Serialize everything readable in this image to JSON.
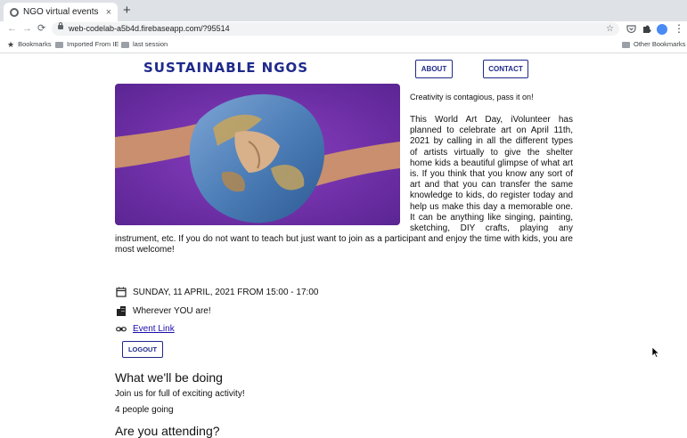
{
  "browser": {
    "tab_title": "NGO virtual events",
    "tab_close": "×",
    "new_tab": "+",
    "back": "←",
    "forward": "→",
    "reload": "⟳",
    "url": "web-codelab-a5b4d.firebaseapp.com/?95514",
    "bookmark_star": "☆",
    "menu": "⋮",
    "bookmarks_bar": {
      "bookmarks_label": "Bookmarks",
      "imported_label": "Imported From IE",
      "last_session_label": "last session",
      "other_bookmarks_label": "Other Bookmarks"
    }
  },
  "header": {
    "site_title": "SUSTAINABLE NGOS",
    "nav": [
      {
        "label": "ABOUT"
      },
      {
        "label": "CONTACT"
      }
    ]
  },
  "event": {
    "tagline": "Creativity is contagious, pass it on!",
    "description": "This World Art Day, iVolunteer has planned to celebrate art on April 11th, 2021 by calling in all the different types of artists virtually to give the shelter home kids a beautiful glimpse of what art is. If you think that you know any sort of art and that you can transfer the same knowledge to kids, do register today and help us make this day a memorable one. It can be anything like singing, painting, sketching, DIY crafts, playing any instrument, etc. If you do not want to teach but just want to join as a participant and enjoy the time with kids, you are most welcome!",
    "date_time": "SUNDAY, 11 APRIL, 2021 FROM 15:00 - 17:00",
    "location": "Wherever YOU are!",
    "event_link_label": "Event Link",
    "logout_label": "LOGOUT",
    "activity_heading": "What we'll be doing",
    "activity_text": "Join us for full of exciting activity!",
    "going_count": "4 people going",
    "attending_heading": "Are you attending?"
  },
  "icons": {
    "calendar": "calendar-icon",
    "location": "building-icon",
    "link": "link-icon"
  },
  "colors": {
    "brand_navy": "#1f2a8a",
    "hero_purple": "#6a2fa0"
  }
}
